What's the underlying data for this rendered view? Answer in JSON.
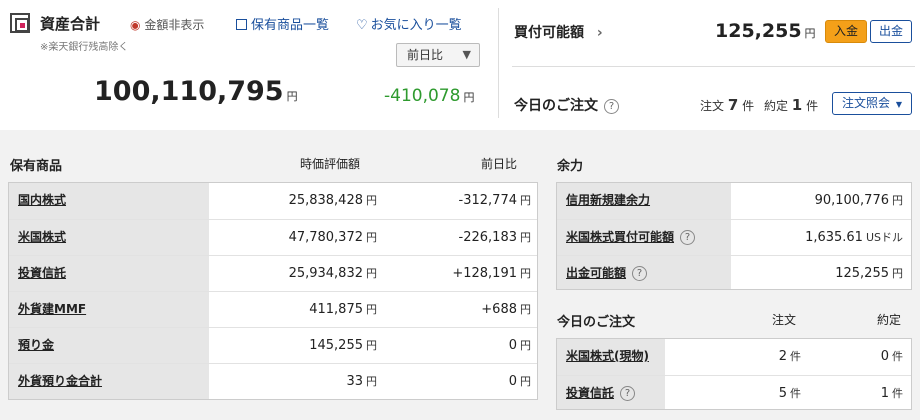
{
  "header": {
    "title": "資産合計",
    "hide_amount": "金額非表示",
    "note": "※楽天銀行残高除く",
    "holdings_link": "保有商品一覧",
    "favorites_link": "お気に入り一覧",
    "compare_select": "前日比",
    "total_value": "100,110,795",
    "total_change": "-410,078",
    "yen": "円"
  },
  "buying_power": {
    "label": "買付可能額",
    "value": "125,255",
    "deposit_button": "入金",
    "withdraw_button": "出金"
  },
  "today_orders_top": {
    "label": "今日のご注文",
    "order_label": "注文",
    "order_count": "7",
    "fill_label": "約定",
    "fill_count": "1",
    "unit": "件",
    "inquiry_button": "注文照会"
  },
  "holdings": {
    "title": "保有商品",
    "col_value": "時価評価額",
    "col_change": "前日比",
    "rows": [
      {
        "name": "国内株式",
        "value": "25,838,428",
        "change": "-312,774"
      },
      {
        "name": "米国株式",
        "value": "47,780,372",
        "change": "-226,183"
      },
      {
        "name": "投資信託",
        "value": "25,934,832",
        "change": "+128,191"
      },
      {
        "name": "外貨建MMF",
        "value": "411,875",
        "change": "+688"
      },
      {
        "name": "預り金",
        "value": "145,255",
        "change": "0"
      },
      {
        "name": "外貨預り金合計",
        "value": "33",
        "change": "0"
      }
    ]
  },
  "margin": {
    "title": "余力",
    "rows": [
      {
        "name": "信用新規建余力",
        "value": "90,100,776",
        "unit": "円"
      },
      {
        "name": "米国株式買付可能額",
        "value": "1,635.61",
        "unit": "USドル"
      },
      {
        "name": "出金可能額",
        "value": "125,255",
        "unit": "円"
      }
    ]
  },
  "today_orders": {
    "title": "今日のご注文",
    "col_order": "注文",
    "col_fill": "約定",
    "rows": [
      {
        "name": "米国株式(現物)",
        "order": "2",
        "fill": "0"
      },
      {
        "name": "投資信託",
        "order": "5",
        "fill": "1"
      }
    ]
  },
  "colors": {
    "negative": "#2e9a2e",
    "positive": "#d0245c",
    "link": "#1a4f9c",
    "accent": "#f4a019"
  },
  "icons": {
    "total": "asset-icon",
    "hide": "eye-icon",
    "list": "list-icon",
    "favorite": "heart-icon",
    "help": "question-icon"
  }
}
